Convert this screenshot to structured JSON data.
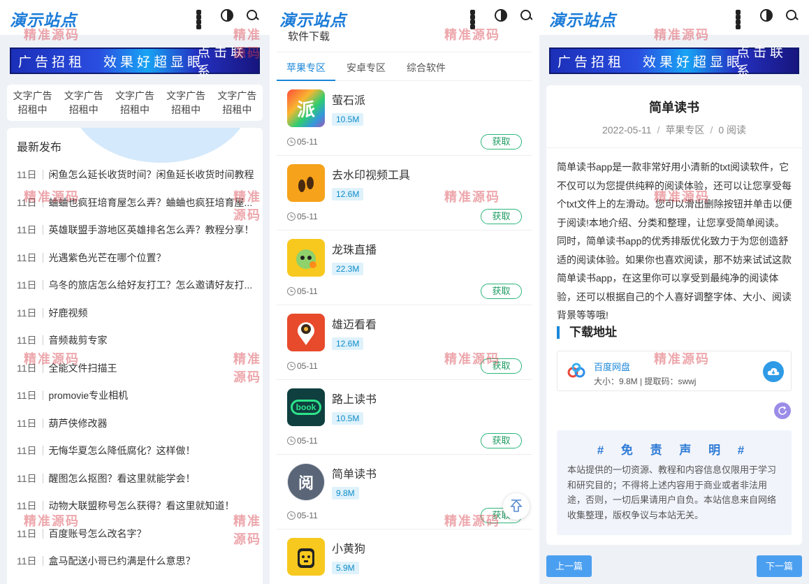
{
  "site": {
    "logo": "演示站点",
    "watermark": "精准源码",
    "icons": [
      "grid-icon",
      "contrast-icon",
      "search-icon"
    ]
  },
  "ad_banner": {
    "part1": "广告招租",
    "part2": "效果好超显眼",
    "part3": "点击联系"
  },
  "text_ads": [
    {
      "line1": "文字广告",
      "line2": "招租中"
    },
    {
      "line1": "文字广告",
      "line2": "招租中"
    },
    {
      "line1": "文字广告",
      "line2": "招租中"
    },
    {
      "line1": "文字广告",
      "line2": "招租中"
    },
    {
      "line1": "文字广告",
      "line2": "招租中"
    }
  ],
  "recent": {
    "heading": "最新发布",
    "items": [
      {
        "day": "11日",
        "title": "闲鱼怎么延长收货时间？闲鱼延长收货时间教程"
      },
      {
        "day": "11日",
        "title": "蛐蛐也疯狂培育屋怎么弄？蛐蛐也疯狂培育屋..."
      },
      {
        "day": "11日",
        "title": "英雄联盟手游地区英雄排名怎么弄？教程分享！"
      },
      {
        "day": "11日",
        "title": "光遇紫色光芒在哪个位置？"
      },
      {
        "day": "11日",
        "title": "乌冬的旅店怎么给好友打工？怎么邀请好友打..."
      },
      {
        "day": "11日",
        "title": "好鹿视频"
      },
      {
        "day": "11日",
        "title": "音频裁剪专家"
      },
      {
        "day": "11日",
        "title": "全能文件扫描王"
      },
      {
        "day": "11日",
        "title": "promovie专业相机"
      },
      {
        "day": "11日",
        "title": "葫芦侠修改器"
      },
      {
        "day": "11日",
        "title": "无悔华夏怎么降低腐化？这样做！"
      },
      {
        "day": "11日",
        "title": "醒图怎么抠图？看这里就能学会！"
      },
      {
        "day": "11日",
        "title": "动物大联盟称号怎么获得？看这里就知道！"
      },
      {
        "day": "11日",
        "title": "百度账号怎么改名字？"
      },
      {
        "day": "11日",
        "title": "盒马配送小哥已约满是什么意思？"
      }
    ]
  },
  "software": {
    "section_title": "软件下载",
    "tabs": [
      "苹果专区",
      "安卓专区",
      "综合软件"
    ],
    "get_label": "获取",
    "apps": [
      {
        "name": "萤石派",
        "size": "10.5M",
        "date": "05-11",
        "icon_text": "派",
        "color": "#e33b2e"
      },
      {
        "name": "去水印视频工具",
        "size": "12.6M",
        "date": "05-11",
        "icon_text": "",
        "color": "#f6a21b"
      },
      {
        "name": "龙珠直播",
        "size": "22.3M",
        "date": "05-11",
        "icon_text": "",
        "color": "#f7c81e"
      },
      {
        "name": "雄迈看看",
        "size": "12.6M",
        "date": "05-11",
        "icon_text": "",
        "color": "#e74b2c"
      },
      {
        "name": "路上读书",
        "size": "10.5M",
        "date": "05-11",
        "icon_text": "book",
        "color": "#0f3f3f"
      },
      {
        "name": "简单读书",
        "size": "9.8M",
        "date": "05-11",
        "icon_text": "阅",
        "color": "#5a6678"
      },
      {
        "name": "小黄狗",
        "size": "5.9M",
        "date": "",
        "icon_text": "",
        "color": "#f7c81e"
      }
    ]
  },
  "article": {
    "title": "简单读书",
    "date": "2022-05-11",
    "category": "苹果专区",
    "views": "0 阅读",
    "body": "简单读书app是一款非常好用小清新的txt阅读软件，它不仅可以为您提供纯粹的阅读体验，还可以让您享受每个txt文件上的左滑动。您可以滑出删除按钮并单击以便于阅读!本地介绍、分类和整理，让您享受简单阅读。同时，简单读书app的优秀排版优化致力于为您创造舒适的阅读体验。如果你也喜欢阅读，那不妨来试试这款简单读书app，在这里你可以享受到最纯净的阅读体验，还可以根据自己的个人喜好调整字体、大小、阅读背景等等哦!",
    "download_heading": "下载地址",
    "download": {
      "name": "百度网盘",
      "info": "大小：9.8M | 提取码：swwj"
    },
    "disclaimer_title": "# 免 责 声 明 #",
    "disclaimer_body": "本站提供的一切资源、教程和内容信息仅限用于学习和研究目的；不得将上述内容用于商业或者非法用途，否则，一切后果请用户自负。本站信息来自网络收集整理，版权争议与本站无关。",
    "prev_label": "上一篇",
    "next_label": "下一篇"
  }
}
